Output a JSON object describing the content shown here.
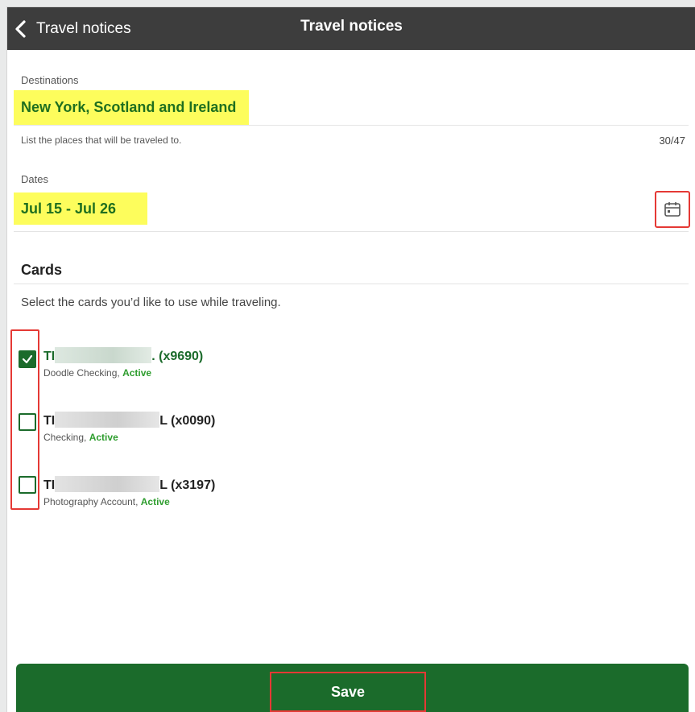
{
  "header": {
    "back_label": "Travel notices",
    "title": "Travel notices"
  },
  "destinations": {
    "label": "Destinations",
    "value": "New York, Scotland and Ireland",
    "helper": "List the places that will be traveled to.",
    "counter": "30/47"
  },
  "dates": {
    "label": "Dates",
    "value": "Jul 15 - Jul 26"
  },
  "cards": {
    "title": "Cards",
    "subtitle": "Select the cards you’d like to use while traveling.",
    "items": [
      {
        "name_start": "TI",
        "name_end": ". (x9690)",
        "account": "Doodle Checking,",
        "status": "Active",
        "checked": true
      },
      {
        "name_start": "TI",
        "name_end": "L (x0090)",
        "account": "Checking,",
        "status": "Active",
        "checked": false
      },
      {
        "name_start": "TI",
        "name_end": "L (x3197)",
        "account": "Photography Account,",
        "status": "Active",
        "checked": false
      }
    ]
  },
  "footer": {
    "save_label": "Save"
  },
  "colors": {
    "header_bg": "#3d3d3d",
    "highlight": "#fdfd5c",
    "brand_green": "#1b6b2b",
    "active_green": "#2e9d2e",
    "annotation_red": "#e53935"
  },
  "icons": {
    "back": "chevron-left-icon",
    "calendar": "calendar-icon",
    "check": "check-icon"
  }
}
